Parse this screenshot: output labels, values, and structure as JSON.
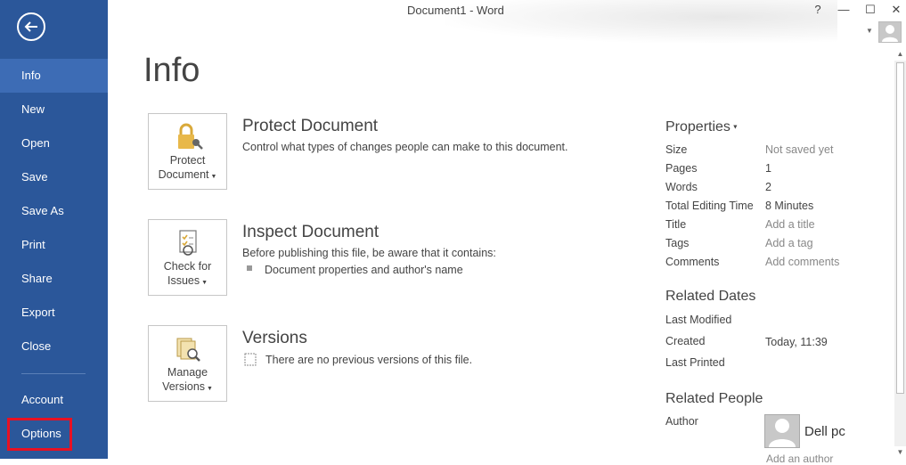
{
  "window": {
    "title": "Document1 - Word",
    "help": "?",
    "minimize": "—",
    "maximize": "☐",
    "close": "✕"
  },
  "sidebar": {
    "items": [
      {
        "label": "Info"
      },
      {
        "label": "New"
      },
      {
        "label": "Open"
      },
      {
        "label": "Save"
      },
      {
        "label": "Save As"
      },
      {
        "label": "Print"
      },
      {
        "label": "Share"
      },
      {
        "label": "Export"
      },
      {
        "label": "Close"
      },
      {
        "label": "Account"
      },
      {
        "label": "Options"
      }
    ],
    "active": "Info",
    "highlighted": "Options",
    "colors": {
      "background": "#2b579a",
      "active": "#3d6cb5",
      "highlight_border": "#e81123"
    }
  },
  "main": {
    "title": "Info",
    "sections": [
      {
        "button_line1": "Protect",
        "button_line2": "Document",
        "title": "Protect Document",
        "desc": "Control what types of changes people can make to this document.",
        "icon": "lock-key-icon"
      },
      {
        "button_line1": "Check for",
        "button_line2": "Issues",
        "title": "Inspect Document",
        "desc": "Before publishing this file, be aware that it contains:",
        "bullet": "Document properties and author's name",
        "icon": "inspect-document-icon"
      },
      {
        "button_line1": "Manage",
        "button_line2": "Versions",
        "title": "Versions",
        "desc": "There are no previous versions of this file.",
        "icon": "manage-versions-icon"
      }
    ]
  },
  "properties": {
    "heading": "Properties",
    "rows": [
      {
        "label": "Size",
        "value": "Not saved yet"
      },
      {
        "label": "Pages",
        "value": "1"
      },
      {
        "label": "Words",
        "value": "2"
      },
      {
        "label": "Total Editing Time",
        "value": "8 Minutes"
      },
      {
        "label": "Title",
        "value": "Add a title"
      },
      {
        "label": "Tags",
        "value": "Add a tag"
      },
      {
        "label": "Comments",
        "value": "Add comments"
      }
    ],
    "related_dates": {
      "heading": "Related Dates",
      "rows": [
        {
          "label": "Last Modified",
          "value": ""
        },
        {
          "label": "Created",
          "value": "Today, 11:39"
        },
        {
          "label": "Last Printed",
          "value": ""
        }
      ]
    },
    "related_people": {
      "heading": "Related People",
      "author_label": "Author",
      "author_name": "Dell pc",
      "add_author": "Add an author"
    }
  }
}
